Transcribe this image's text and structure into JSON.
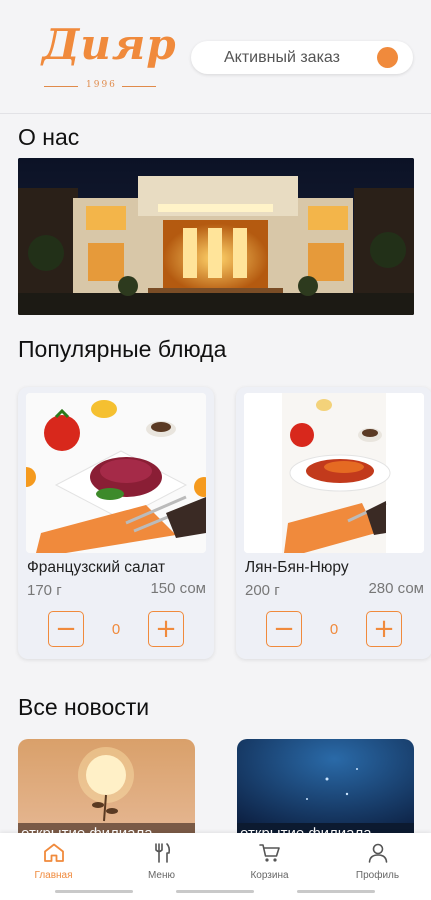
{
  "header": {
    "logo_text": "Дияр",
    "logo_year": "1996",
    "active_order_label": "Активный заказ"
  },
  "about": {
    "title": "О нас"
  },
  "popular": {
    "title": "Популярные блюда",
    "dishes": [
      {
        "name": "Французский салат",
        "weight": "170 г",
        "price": "150 сом",
        "quantity": "0",
        "minus_label": "−",
        "plus_label": "+"
      },
      {
        "name": "Лян-Бян-Нюру",
        "weight": "200 г",
        "price": "280 сом",
        "quantity": "0",
        "minus_label": "−",
        "plus_label": "+"
      }
    ]
  },
  "news": {
    "title": "Все новости",
    "items": [
      {
        "caption": "открытие филиала"
      },
      {
        "caption": "открытие филиала"
      }
    ]
  },
  "bottom_nav": {
    "items": [
      {
        "label": "Главная",
        "icon": "home-icon",
        "active": true
      },
      {
        "label": "Меню",
        "icon": "cutlery-icon",
        "active": false
      },
      {
        "label": "Корзина",
        "icon": "cart-icon",
        "active": false
      },
      {
        "label": "Профиль",
        "icon": "user-icon",
        "active": false
      }
    ]
  },
  "colors": {
    "accent": "#f08a3c",
    "background": "#f4f4f6",
    "card": "#eef0f6"
  }
}
